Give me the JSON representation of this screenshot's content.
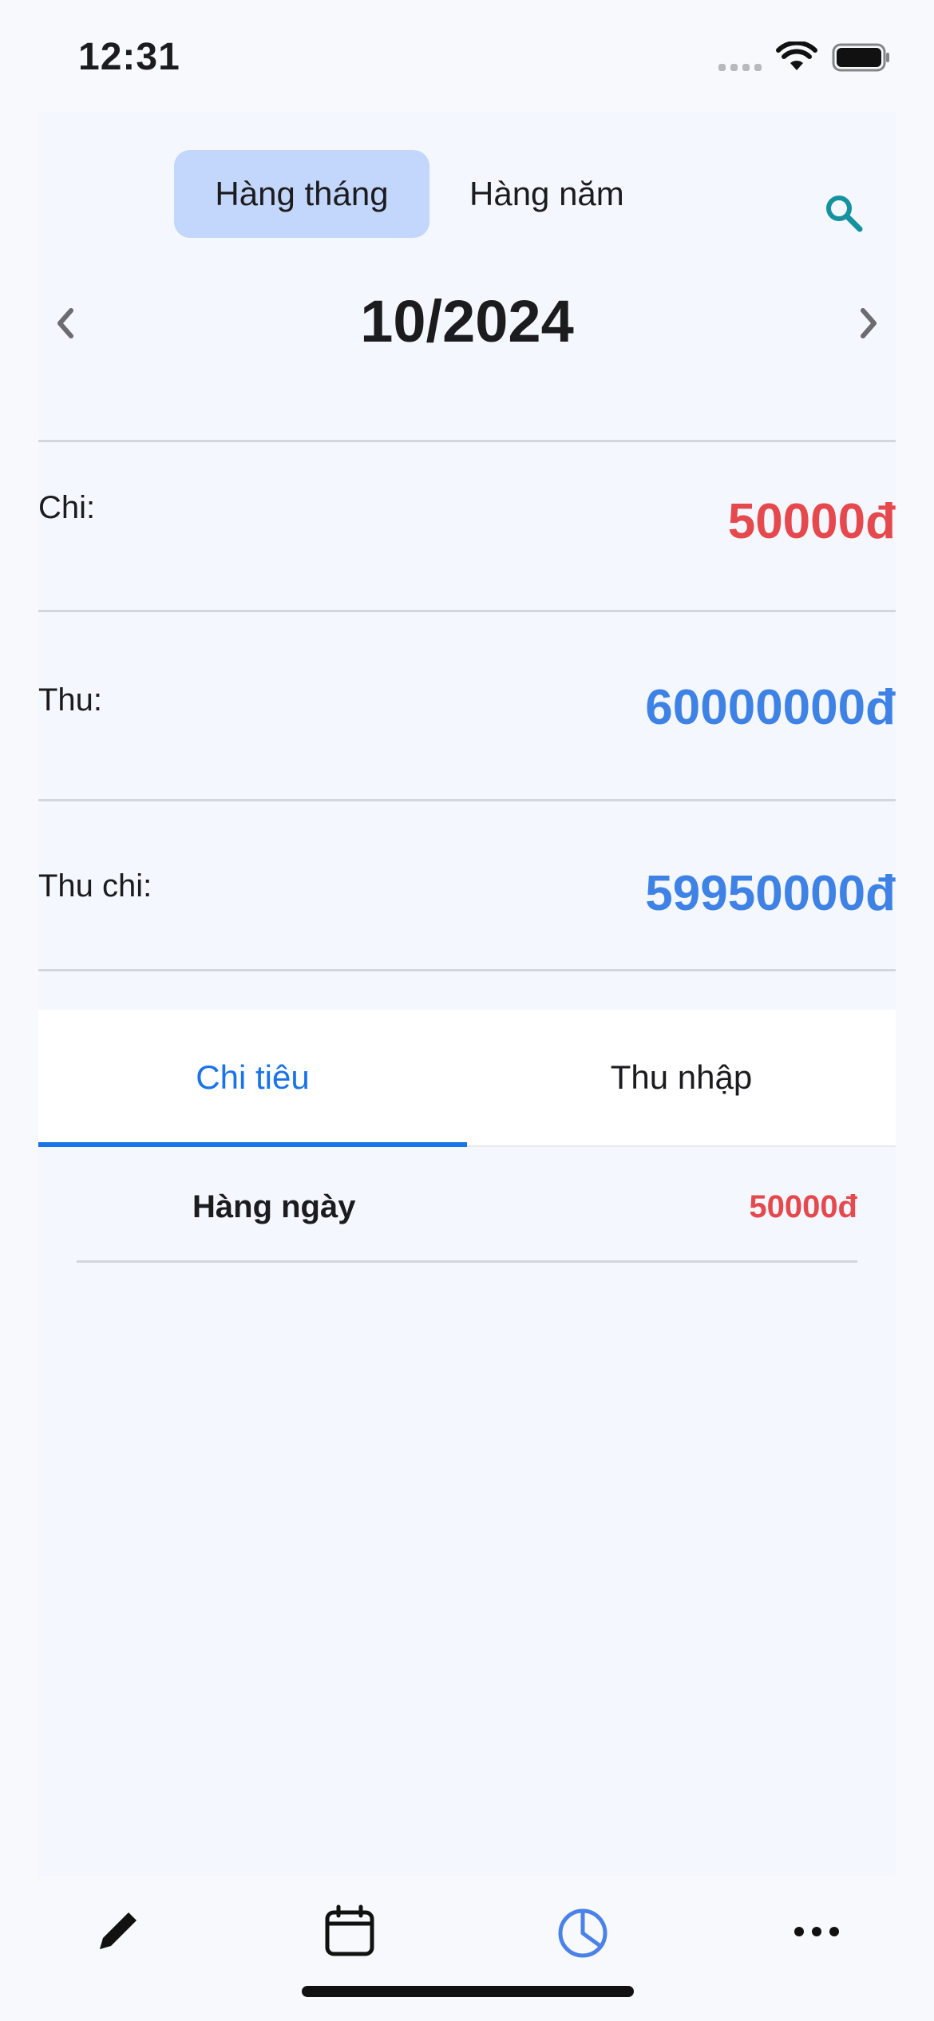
{
  "status_bar": {
    "time": "12:31"
  },
  "period_toggle": {
    "monthly_label": "Hàng tháng",
    "yearly_label": "Hàng năm",
    "selected": "monthly"
  },
  "month_nav": {
    "current": "10/2024"
  },
  "summary": {
    "expense": {
      "label": "Chi:",
      "value": "50000đ"
    },
    "income": {
      "label": "Thu:",
      "value": "60000000đ"
    },
    "balance": {
      "label": "Thu chi:",
      "value": "59950000đ"
    }
  },
  "tabs": {
    "expense_label": "Chi tiêu",
    "income_label": "Thu nhập",
    "selected": "expense"
  },
  "categories": [
    {
      "name": "Hàng ngày",
      "amount": "50000đ"
    }
  ],
  "bottom_nav": {
    "items": [
      {
        "icon": "pencil-icon"
      },
      {
        "icon": "calendar-icon"
      },
      {
        "icon": "pie-chart-icon",
        "active": true
      },
      {
        "icon": "more-icon"
      }
    ]
  },
  "colors": {
    "accent": "#1a73e8",
    "expense": "#e5484d",
    "income": "#3f82e5",
    "toggle_active": "#c3d6fb",
    "search_icon": "#1592a0"
  }
}
